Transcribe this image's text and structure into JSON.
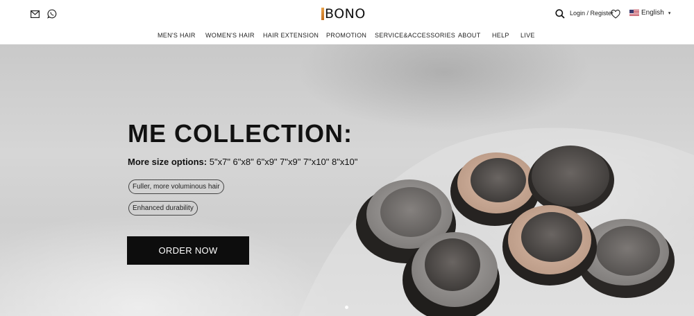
{
  "header": {
    "logo_text": "BONO",
    "login_label": "Login / Register",
    "language": {
      "label": "English",
      "caret": "▾"
    }
  },
  "nav": {
    "items": [
      "MEN'S HAIR",
      "WOMEN'S HAIR",
      "HAIR EXTENSION",
      "PROMOTION",
      "SERVICE&ACCESSORIES",
      "ABOUT",
      "HELP",
      "LIVE"
    ]
  },
  "hero": {
    "title": "ME COLLECTION:",
    "sizes_label": "More size options:",
    "sizes_values": "5\"x7\"  6\"x8\"  6\"x9\"  7\"x9\"  7\"x10\"  8\"x10\"",
    "features": [
      "Fuller, more voluminous hair",
      "Enhanced durability"
    ],
    "cta_label": "ORDER NOW",
    "slide_count": 1
  },
  "icons": [
    "mail-icon",
    "whatsapp-icon",
    "search-icon",
    "heart-icon",
    "us-flag-icon"
  ],
  "colors": {
    "accent_logo": "#d9893a",
    "cta_background": "#0d0d0d",
    "text": "#111111"
  }
}
